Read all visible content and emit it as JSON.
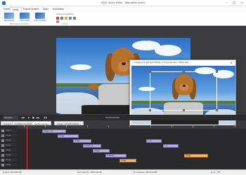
{
  "window": {
    "title": "VSDC Video Editor - Wonderful scene",
    "controls": {
      "minimize": "–",
      "maximize": "□",
      "close": "×"
    }
  },
  "ribbon_tabs": [
    {
      "label": "Projects"
    },
    {
      "label": "Editor"
    },
    {
      "label": "Export project"
    },
    {
      "label": "Tools"
    },
    {
      "label": "Activation"
    }
  ],
  "ribbon": {
    "tools": [
      {
        "label": "Remove all",
        "icon": "remove-all-icon"
      },
      {
        "label": "Auto levels",
        "icon": "auto-levels-icon"
      },
      {
        "label": "Auto contrast",
        "icon": "auto-contrast-icon"
      }
    ],
    "cutting_label": "Cutting and splitting",
    "group_quick": "Removing quick styles",
    "group_tools": "Tools"
  },
  "dialog": {
    "title": "Image.vsf (gfhdvkhlH6jQ_0 Original size: 1584x720",
    "close": "×",
    "position_text": "Position: 386, 86, 879, 390 (793x412)",
    "set_original_button": "Set the original size",
    "ok_button": "OK",
    "cancel_button": "Cancel",
    "time": "00:00:00.00"
  },
  "transport": {
    "quality": "Preview",
    "time": "00:00:00.000"
  },
  "scene_tabs": [
    {
      "label": "Scene 0"
    },
    {
      "label": "Crystals (Crystals)"
    },
    {
      "label": "Sprite: Sprite1"
    },
    {
      "label": "Image: vsf (gfhdvkhlH..."
    }
  ],
  "timeline": {
    "tracks": [
      {
        "name": "Layer 1"
      },
      {
        "name": "Image"
      },
      {
        "name": "Image"
      },
      {
        "name": "Image"
      },
      {
        "name": "Image"
      },
      {
        "name": "Image"
      },
      {
        "name": "Image"
      },
      {
        "name": "Image"
      }
    ],
    "clips": [
      {
        "label": "Image: vsf...",
        "style": "purple"
      },
      {
        "label": "Image",
        "style": "purple"
      },
      {
        "label": "Image",
        "style": "purple"
      },
      {
        "label": "sunset_01",
        "style": "purple"
      },
      {
        "label": "Image",
        "style": "purple"
      },
      {
        "label": "FeNSOD...",
        "style": "purple"
      },
      {
        "label": "Image",
        "style": "orange"
      },
      {
        "label": "1_20",
        "style": "purple"
      },
      {
        "label": "1_2",
        "style": "purple"
      },
      {
        "label": "Image",
        "style": "orange"
      }
    ]
  },
  "statusbar": {
    "position": "Position:  00:00:00.000",
    "start": "Start selection:  00:00:00.000",
    "end": "End selection:  00:00:00.000",
    "zoom": "Zoom:  23%"
  },
  "colors": {
    "accent": "#1e73be",
    "timeline_bg": "#2a2a2d",
    "clip_purple": "#b9b2e0",
    "clip_orange": "#f0b874",
    "playhead": "#e53935"
  }
}
